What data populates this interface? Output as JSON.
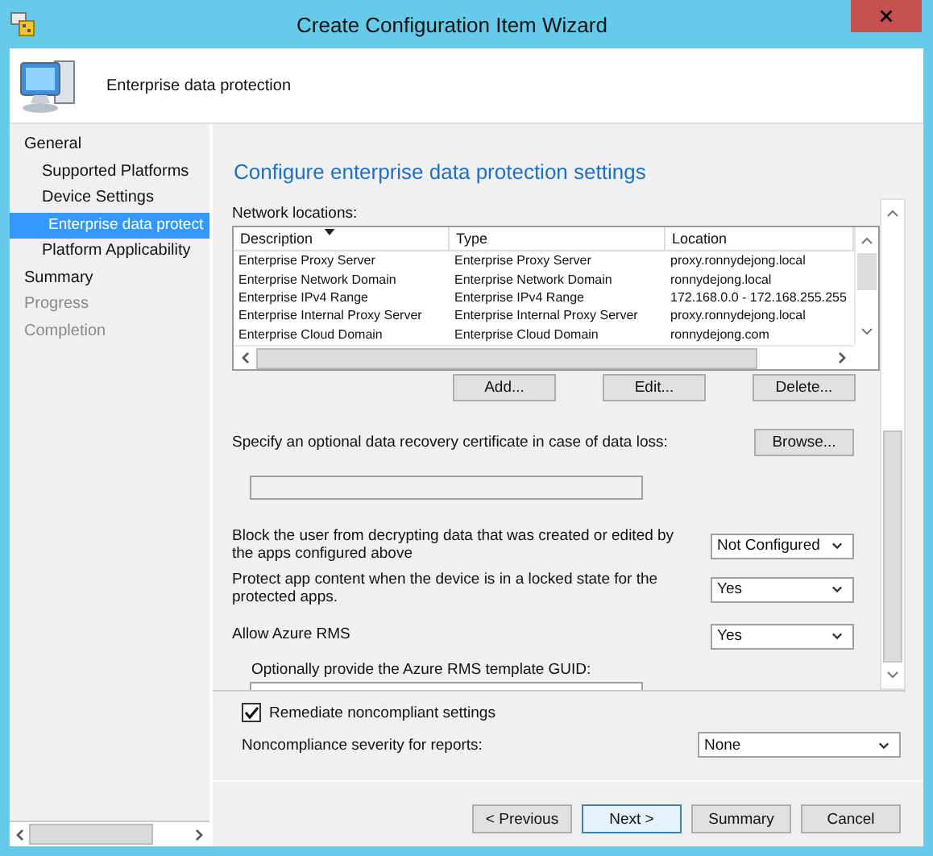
{
  "window": {
    "title": "Create Configuration Item Wizard"
  },
  "header": {
    "title": "Enterprise data protection"
  },
  "sidebar": {
    "items": [
      {
        "label": "General",
        "selected": false,
        "disabled": false,
        "children": [
          {
            "label": "Supported Platforms",
            "selected": false,
            "disabled": false
          },
          {
            "label": "Device Settings",
            "selected": false,
            "disabled": false,
            "children": [
              {
                "label": "Enterprise data protect",
                "selected": true,
                "disabled": false
              }
            ]
          },
          {
            "label": "Platform Applicability",
            "selected": false,
            "disabled": false
          }
        ]
      },
      {
        "label": "Summary",
        "selected": false,
        "disabled": false
      },
      {
        "label": "Progress",
        "selected": false,
        "disabled": true
      },
      {
        "label": "Completion",
        "selected": false,
        "disabled": true
      }
    ]
  },
  "page": {
    "title": "Configure enterprise data protection settings",
    "network_locations": {
      "label": "Network locations:",
      "columns": [
        {
          "label": "Description",
          "sorted": true
        },
        {
          "label": "Type",
          "sorted": false
        },
        {
          "label": "Location",
          "sorted": false
        }
      ],
      "rows": [
        [
          "Enterprise Proxy Server",
          "Enterprise Proxy Server",
          "proxy.ronnydejong.local"
        ],
        [
          "Enterprise Network Domain",
          "Enterprise Network Domain",
          "ronnydejong.local"
        ],
        [
          "Enterprise IPv4 Range",
          "Enterprise IPv4 Range",
          "172.168.0.0 - 172.168.255.255"
        ],
        [
          "Enterprise Internal Proxy Server",
          "Enterprise Internal Proxy Server",
          "proxy.ronnydejong.local"
        ],
        [
          "Enterprise Cloud Domain",
          "Enterprise Cloud Domain",
          "ronnydejong.com"
        ]
      ],
      "buttons": [
        "Add...",
        "Edit...",
        "Delete..."
      ]
    },
    "certificate": {
      "label": "Specify an optional data recovery certificate in case of data loss:",
      "button": "Browse..."
    },
    "settings": [
      {
        "label": "Block the user from decrypting data that was created or edited by the apps configured above",
        "value": "Not Configured"
      },
      {
        "label": "Protect app content when the device is in a locked state for the protected apps.",
        "value": "Yes"
      },
      {
        "label": "Allow Azure RMS",
        "value": "Yes"
      }
    ],
    "guid": {
      "label": "Optionally provide the Azure RMS template GUID:"
    },
    "remediate": {
      "label": "Remediate noncompliant settings",
      "checked": true
    },
    "severity": {
      "label": "Noncompliance severity for reports:",
      "value": "None"
    }
  },
  "buttons": [
    {
      "label": "< Previous",
      "default": false
    },
    {
      "label": "Next >",
      "default": true
    },
    {
      "label": "Summary",
      "default": false
    },
    {
      "label": "Cancel",
      "default": false
    }
  ]
}
